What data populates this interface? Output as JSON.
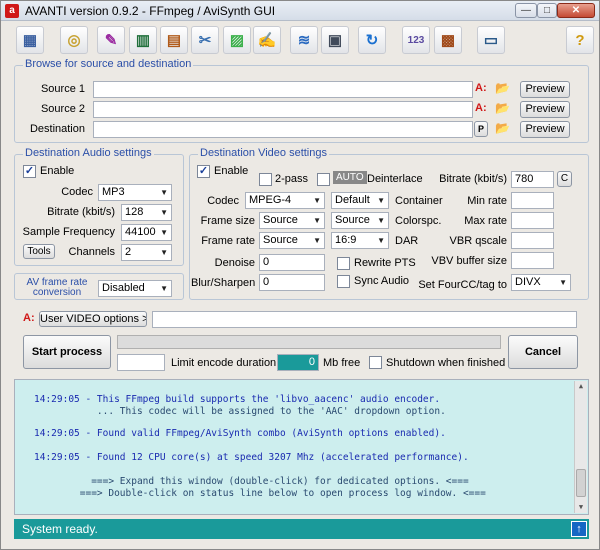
{
  "window": {
    "app_icon": "a",
    "title": "AVANTI  version  0.9.2   -   FFmpeg / AviSynth GUI",
    "minimize": "—",
    "maximize": "□",
    "close": "✕"
  },
  "toolbar": {
    "buttons": [
      {
        "icon": "film-strip-icon",
        "glyph": "▦",
        "color": "#3a5fa0"
      },
      {
        "icon": "disc-icon",
        "glyph": "◎",
        "color": "#c7a232"
      },
      {
        "icon": "paint-brush-icon",
        "glyph": "✎",
        "color": "#9a2aa0"
      },
      {
        "icon": "frames-icon",
        "glyph": "▥",
        "color": "#1f6f3a"
      },
      {
        "icon": "audio-frames-icon",
        "glyph": "▤",
        "color": "#b05a1a"
      },
      {
        "icon": "video-tools-icon",
        "glyph": "✂",
        "color": "#3a70b0"
      },
      {
        "icon": "gradient-icon",
        "glyph": "▨",
        "color": "#3ab04a"
      },
      {
        "icon": "notepad-pen-icon",
        "glyph": "✍",
        "color": "#704a2a"
      },
      {
        "icon": "waveform-icon",
        "glyph": "≋",
        "color": "#2a6ac0"
      },
      {
        "icon": "disk-copy-icon",
        "glyph": "▣",
        "color": "#404a5a"
      },
      {
        "icon": "refresh-icon",
        "glyph": "↻",
        "color": "#1a70d0"
      },
      {
        "icon": "numbers-icon",
        "glyph": "123",
        "color": "#5a4aa0"
      },
      {
        "icon": "film-cut-icon",
        "glyph": "▩",
        "color": "#a04a1a"
      },
      {
        "icon": "monitor-icon",
        "glyph": "▭",
        "color": "#2a5a8a"
      },
      {
        "icon": "help-icon",
        "glyph": "?",
        "color": "#d09a10"
      }
    ]
  },
  "browse": {
    "legend": "Browse for source and destination",
    "source1_label": "Source 1",
    "source2_label": "Source 2",
    "destination_label": "Destination",
    "source1_value": "",
    "source2_value": "",
    "destination_value": "",
    "avisynth_flag": "A:",
    "p_label": "P",
    "open_icon": "📂",
    "preview_label": "Preview"
  },
  "audio": {
    "legend": "Destination Audio settings",
    "enable_label": "Enable",
    "enable_checked": "✓",
    "codec_label": "Codec",
    "codec_value": "MP3",
    "bitrate_label": "Bitrate (kbit/s)",
    "bitrate_value": "128",
    "sample_label": "Sample Frequency",
    "sample_value": "44100",
    "tools_label": "Tools",
    "channels_label": "Channels",
    "channels_value": "2"
  },
  "av_frame": {
    "label": "AV frame rate conversion",
    "value": "Disabled"
  },
  "video": {
    "legend": "Destination Video settings",
    "enable_label": "Enable",
    "enable_checked": "✓",
    "twopass_label": "2-pass",
    "auto_label": "AUTO",
    "deinterlace_label": "Deinterlace",
    "bitrate_label": "Bitrate (kbit/s)",
    "bitrate_value": "780",
    "c_label": "C",
    "codec_label": "Codec",
    "codec_value": "MPEG-4",
    "container_value": "Default",
    "container_label": "Container",
    "minrate_label": "Min rate",
    "framesize_label": "Frame size",
    "framesize_value": "Source",
    "colorspc_value": "Source",
    "colorspc_label": "Colorspc.",
    "maxrate_label": "Max rate",
    "framerate_label": "Frame rate",
    "framerate_value": "Source",
    "dar_value": "16:9",
    "dar_label": "DAR",
    "vbrq_label": "VBR qscale",
    "denoise_label": "Denoise",
    "denoise_value": "0",
    "rewrite_label": "Rewrite PTS",
    "vbv_label": "VBV buffer size",
    "blur_label": "Blur/Sharpen",
    "blur_value": "0",
    "sync_label": "Sync Audio",
    "fourcc_label": "Set FourCC/tag to",
    "fourcc_value": "DIVX"
  },
  "user_options": {
    "flag": "A:",
    "label": "User VIDEO options >",
    "value": ""
  },
  "process": {
    "start_label": "Start process",
    "cancel_label": "Cancel",
    "limit_label": "Limit encode duration",
    "mb_value": "0",
    "mb_label": "Mb free",
    "shutdown_label": "Shutdown when finished"
  },
  "log": {
    "lines": [
      "14:29:05 - This FFmpeg build supports the 'libvo_aacenc' audio encoder.",
      "           ... This codec will be assigned to the 'AAC' dropdown option.",
      "14:29:05 - Found valid FFmpeg/AviSynth combo (AviSynth options enabled).",
      "14:29:05 - Found 12 CPU core(s) at speed 3207 Mhz (accelerated performance).",
      "          ===> Expand this window (double-click) for dedicated options. <===",
      "        ===> Double-click on status line below to open process log window. <==="
    ]
  },
  "status": {
    "text": "System ready.",
    "up_icon": "↑"
  }
}
